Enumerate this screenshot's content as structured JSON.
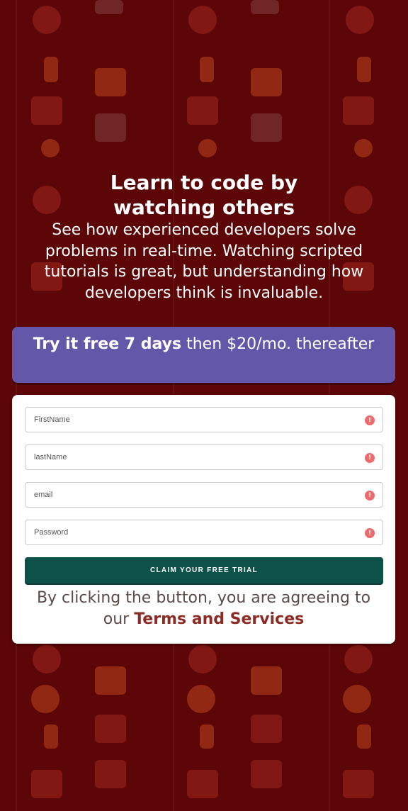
{
  "hero": {
    "title": "Learn to code by watching others",
    "subtitle": "See how experienced developers solve problems in real-time. Watching scripted tutorials is great, but understanding how developers think is invaluable."
  },
  "offer": {
    "bold": "Try it free 7 days",
    "rest": " then $20/mo. thereafter"
  },
  "form": {
    "fields": [
      {
        "placeholder": "FirstName",
        "icon": "alert-icon"
      },
      {
        "placeholder": "lastName",
        "icon": "alert-icon"
      },
      {
        "placeholder": "email",
        "icon": "alert-icon"
      },
      {
        "placeholder": "Password",
        "icon": "alert-icon"
      }
    ],
    "alert_glyph": "!",
    "submit_label": "CLAIM YOUR FREE TRIAL",
    "terms_text": "By clicking the button, you are agreeing to",
    "terms_prefix": "our",
    "terms_link": "Terms and Services"
  },
  "colors": {
    "background": "#5c0607",
    "offer": "#6357aa",
    "submit": "#0d5149",
    "alert": "#ef6b6b",
    "terms_link": "#8c2a24"
  }
}
